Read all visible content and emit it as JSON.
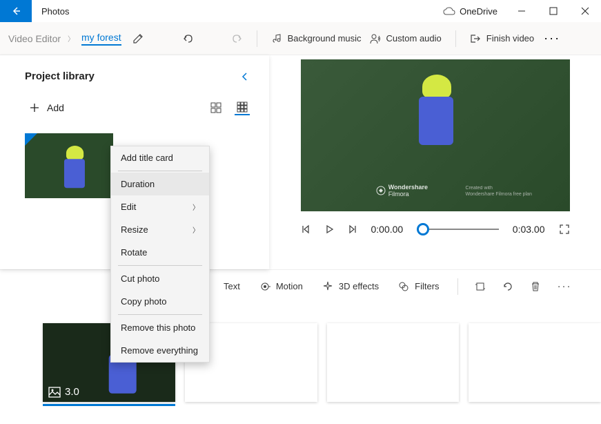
{
  "titlebar": {
    "app_name": "Photos",
    "onedrive": "OneDrive"
  },
  "breadcrumb": {
    "root": "Video Editor",
    "current": "my forest"
  },
  "toolbar": {
    "bg_music": "Background music",
    "custom_audio": "Custom audio",
    "finish": "Finish video"
  },
  "library": {
    "title": "Project library",
    "add": "Add"
  },
  "playback": {
    "current": "0:00.00",
    "total": "0:03.00"
  },
  "storyboard_tb": {
    "text": "Text",
    "motion": "Motion",
    "effects": "3D effects",
    "filters": "Filters"
  },
  "clips": [
    {
      "duration": "3.0"
    }
  ],
  "context_menu": {
    "items": [
      {
        "label": "Add title card",
        "submenu": false
      },
      {
        "label": "Duration",
        "submenu": false,
        "hover": true
      },
      {
        "label": "Edit",
        "submenu": true
      },
      {
        "label": "Resize",
        "submenu": true
      },
      {
        "label": "Rotate",
        "submenu": false
      },
      {
        "label": "Cut photo",
        "submenu": false
      },
      {
        "label": "Copy photo",
        "submenu": false
      },
      {
        "label": "Remove this photo",
        "submenu": false
      },
      {
        "label": "Remove everything",
        "submenu": false
      }
    ]
  },
  "watermark": {
    "brand": "Wondershare",
    "product": "Filmora",
    "note1": "Created with",
    "note2": "Wondershare Filmora free plan"
  }
}
